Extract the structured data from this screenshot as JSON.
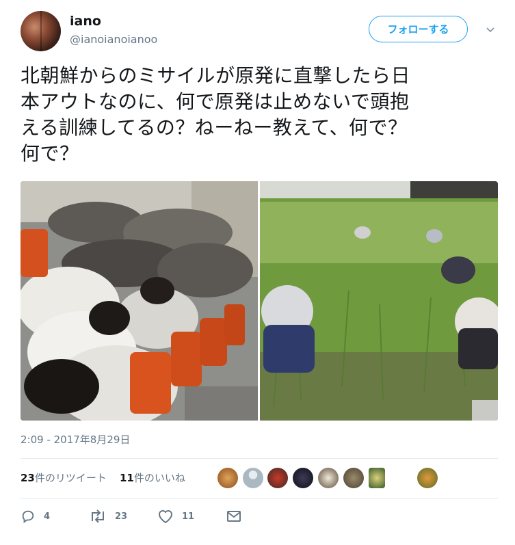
{
  "user": {
    "name": "iano",
    "handle": "@ianoianoianoo",
    "follow_label": "フォローする"
  },
  "tweet": {
    "lines": [
      "北朝鮮からのミサイルが原発に直撃したら日",
      "本アウトなのに、何で原発は止めないで頭抱",
      "える訓練してるの？ねーねー教えて、何で？",
      "何で？"
    ],
    "timestamp": "2:09 - 2017年8月29日"
  },
  "stats": {
    "retweets_count": "23",
    "retweets_label": "件のリツイート",
    "likes_count": "11",
    "likes_label": "件のいいね"
  },
  "actions": {
    "reply_count": "4",
    "retweet_count": "23",
    "like_count": "11"
  },
  "colors": {
    "accent": "#1da1f2",
    "muted": "#657786"
  },
  "icons": [
    "chevron-down-icon",
    "reply-icon",
    "retweet-icon",
    "heart-icon",
    "mail-icon"
  ]
}
